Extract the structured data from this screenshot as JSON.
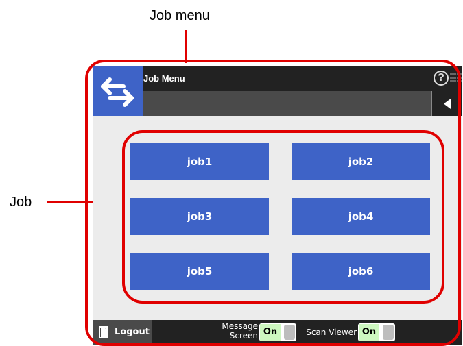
{
  "annotations": {
    "job_menu_label": "Job menu",
    "job_label": "Job",
    "color": "#e00000"
  },
  "app": {
    "title": "Job Menu",
    "home_icon": "swap-arrows-icon",
    "help_icon": "help-icon",
    "keyboard_icon": "keyboard-icon",
    "back_icon": "back-triangle-icon",
    "accent": "#3e63c7"
  },
  "jobs": [
    "job1",
    "job2",
    "job3",
    "job4",
    "job5",
    "job6"
  ],
  "bottom": {
    "logout_label": "Logout",
    "message_screen_label_line1": "Message",
    "message_screen_label_line2": "Screen",
    "message_screen_value": "On",
    "scan_viewer_label": "Scan Viewer",
    "scan_viewer_value": "On"
  }
}
